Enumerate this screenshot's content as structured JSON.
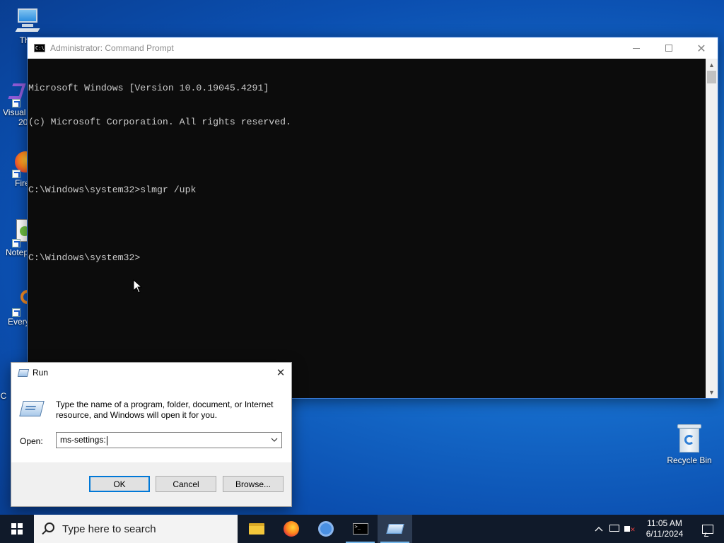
{
  "desktop": {
    "icons": [
      {
        "label": "This"
      },
      {
        "label": "Visual"
      },
      {
        "label": "20"
      },
      {
        "label": "Fire"
      },
      {
        "label": "Notep"
      },
      {
        "label": "Every"
      },
      {
        "label": "C"
      }
    ],
    "recycle_bin": {
      "label": "Recycle Bin"
    }
  },
  "cmd": {
    "title": "Administrator: Command Prompt",
    "lines": [
      "Microsoft Windows [Version 10.0.19045.4291]",
      "(c) Microsoft Corporation. All rights reserved.",
      "",
      "C:\\Windows\\system32>slmgr /upk",
      "",
      "C:\\Windows\\system32>"
    ]
  },
  "run": {
    "title": "Run",
    "description": "Type the name of a program, folder, document, or Internet resource, and Windows will open it for you.",
    "open_label": "Open:",
    "open_value": "ms-settings:",
    "ok_label": "OK",
    "cancel_label": "Cancel",
    "browse_label": "Browse..."
  },
  "taskbar": {
    "search_placeholder": "Type here to search",
    "apps": [
      "file-explorer",
      "firefox",
      "chrome",
      "command-prompt",
      "run"
    ],
    "time": "11:05 AM",
    "date": "6/11/2024"
  },
  "colors": {
    "console_bg": "#0c0c0c",
    "console_fg": "#cccccc",
    "accent": "#0078d7",
    "taskbar": "#101a2a"
  }
}
